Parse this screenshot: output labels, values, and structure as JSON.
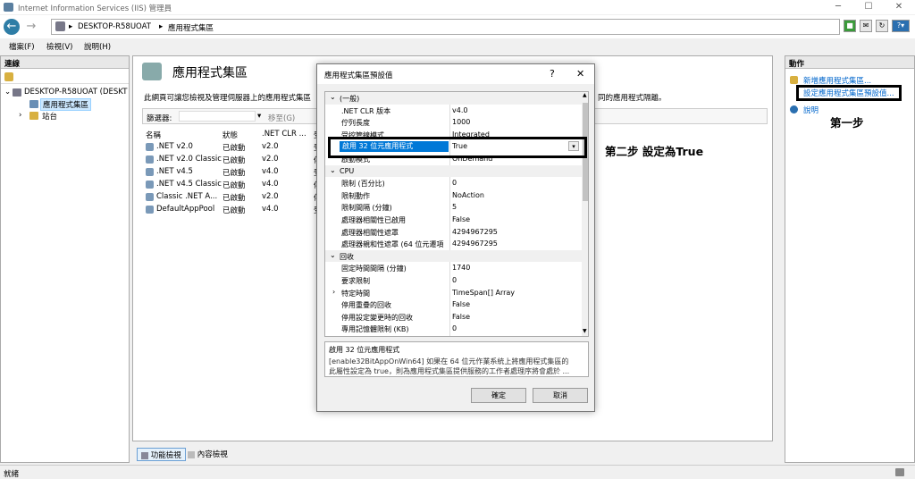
{
  "window": {
    "title": "Internet Information Services (IIS) 管理員"
  },
  "address": {
    "server": "DESKTOP-R58UOAT",
    "page": "應用程式集區"
  },
  "menu": [
    "檔案(F)",
    "檢視(V)",
    "說明(H)"
  ],
  "connections": {
    "header": "連線",
    "server": "DESKTOP-R58UOAT (DESKT",
    "pools": "應用程式集區",
    "sites": "站台"
  },
  "center": {
    "title": "應用程式集區",
    "desc": "此網頁可讓您檢視及管理伺服器上的應用程式集區",
    "desc_right": "同的應用程式隔離。",
    "filter_label": "篩選器:",
    "go_label": "移至(G)",
    "columns": [
      "名稱",
      "狀態",
      ".NET CLR ...",
      "受"
    ],
    "rows": [
      {
        "name": ".NET v2.0",
        "status": "已啟動",
        "clr": "v2.0",
        "pipe": "受"
      },
      {
        "name": ".NET v2.0 Classic",
        "status": "已啟動",
        "clr": "v2.0",
        "pipe": "傳"
      },
      {
        "name": ".NET v4.5",
        "status": "已啟動",
        "clr": "v4.0",
        "pipe": "受"
      },
      {
        "name": ".NET v4.5 Classic",
        "status": "已啟動",
        "clr": "v4.0",
        "pipe": "傳"
      },
      {
        "name": "Classic .NET A...",
        "status": "已啟動",
        "clr": "v2.0",
        "pipe": "傳"
      },
      {
        "name": "DefaultAppPool",
        "status": "已啟動",
        "clr": "v4.0",
        "pipe": "受"
      }
    ],
    "tab_features": "功能檢視",
    "tab_content": "內容檢視"
  },
  "status": "就緒",
  "dialog": {
    "title": "應用程式集區預設值",
    "help": "?",
    "close": "✕",
    "rows": [
      {
        "type": "cat",
        "k": "(一般)"
      },
      {
        "k": ".NET CLR 版本",
        "v": "v4.0"
      },
      {
        "k": "佇列長度",
        "v": "1000"
      },
      {
        "k": "受控管線模式",
        "v": "Integrated"
      },
      {
        "k": "啟用 32 位元應用程式",
        "v": "True",
        "sel": true
      },
      {
        "k": "啟動模式",
        "v": "OnDemand"
      },
      {
        "type": "cat",
        "k": "CPU"
      },
      {
        "k": "限制 (百分比)",
        "v": "0"
      },
      {
        "k": "限制動作",
        "v": "NoAction"
      },
      {
        "k": "限制間隔 (分鐘)",
        "v": "5"
      },
      {
        "k": "處理器相關性已啟用",
        "v": "False"
      },
      {
        "k": "處理器相關性遮罩",
        "v": "4294967295"
      },
      {
        "k": "處理器親和性遮罩 (64 位元遷項",
        "v": "4294967295"
      },
      {
        "type": "cat",
        "k": "回收"
      },
      {
        "k": "固定時間間隔 (分鐘)",
        "v": "1740"
      },
      {
        "k": "要求限制",
        "v": "0"
      },
      {
        "k": "特定時間",
        "v": "TimeSpan[] Array",
        "exp": true
      },
      {
        "k": "停用重疊的回收",
        "v": "False"
      },
      {
        "k": "停用設定變更時的回收",
        "v": "False"
      },
      {
        "k": "專用記憶體限制 (KB)",
        "v": "0"
      }
    ],
    "desc_title": "啟用 32 位元應用程式",
    "desc_line1": "[enable32BitAppOnWin64] 如果在 64 位元作業系統上將應用程式集區的",
    "desc_line2": "此屬性設定為 true，則為應用程式集區提供服務的工作者處理序將會處於 ...",
    "ok": "確定",
    "cancel": "取消"
  },
  "actions": {
    "header": "動作",
    "add": "新增應用程式集區...",
    "set_defaults": "設定應用程式集區預設值...",
    "help": "說明"
  },
  "annotations": {
    "step1": "第一步",
    "step2": "第二步 設定為True"
  }
}
